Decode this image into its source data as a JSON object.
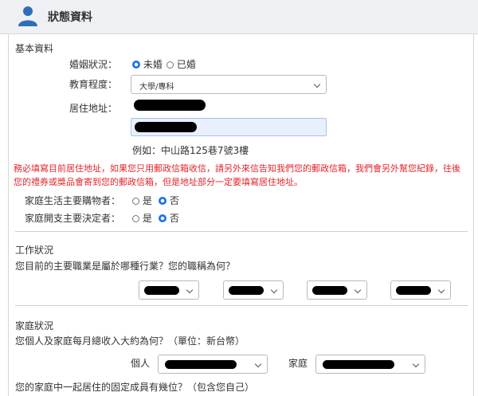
{
  "header": {
    "title": "狀態資料"
  },
  "basic": {
    "section_title": "基本資料",
    "marital_label": "婚姻狀況：",
    "marital_options": [
      "未婚",
      "已婚"
    ],
    "education_label": "教育程度：",
    "education_value": "大學/專科",
    "address_label": "居住地址：",
    "address_example": "例如：中山路125巷7號3樓",
    "warning": "務必填寫目前居住地址，如果您只用郵政信箱收信，請另外來信告知我們您的郵政信箱，我們會另外幫您紀錄，往後您的禮券或獎品會寄到您的郵政信箱，但是地址部分一定要填寫居住地址。",
    "shopper_label": "家庭生活主要購物者：",
    "decider_label": "家庭開支主要決定者：",
    "yesno_options": [
      "是",
      "否"
    ]
  },
  "work": {
    "section_title": "工作狀況",
    "question": "您目前的主要職業是屬於哪種行業？您的職稱為何？"
  },
  "family": {
    "section_title": "家庭狀況",
    "income_question": "您個人及家庭每月總收入大約為何？（單位：新台幣）",
    "personal_label": "個人",
    "household_label": "家庭",
    "members_question": "您的家庭中一起居住的固定成員有幾位？（包含您自己）"
  }
}
